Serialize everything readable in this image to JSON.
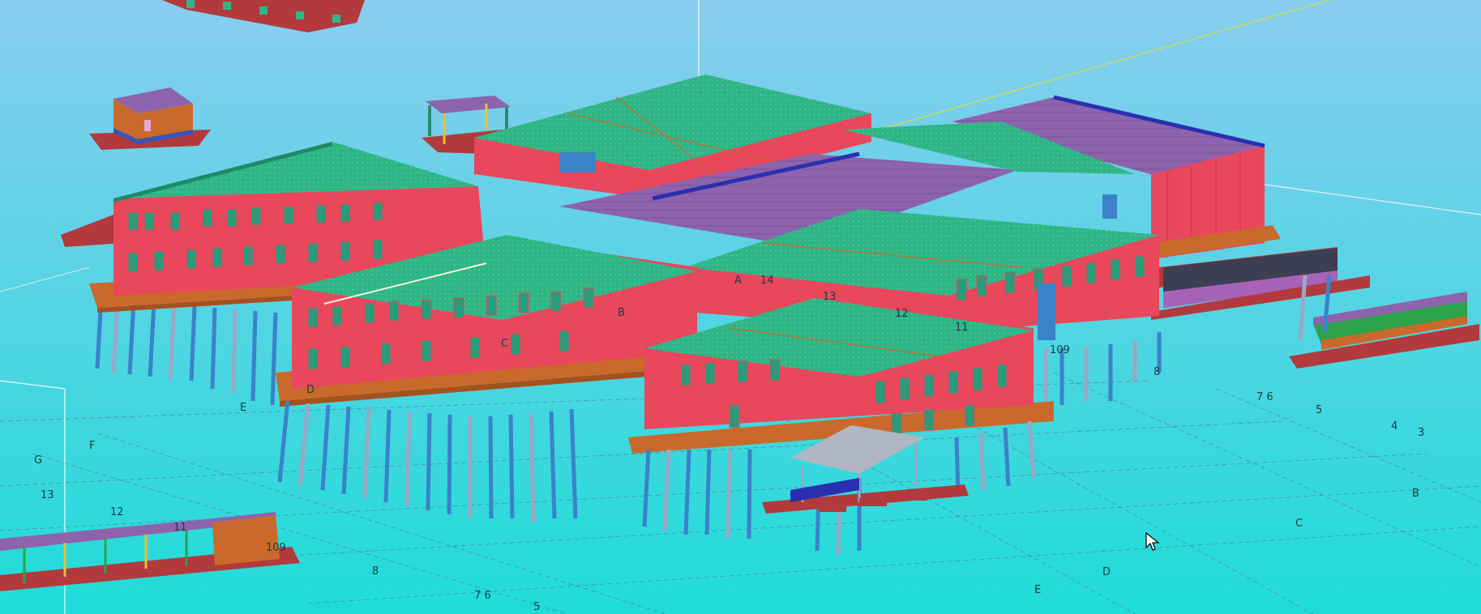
{
  "viewport": {
    "background_top": "#89cdef",
    "background_bottom": "#1fdcd8"
  },
  "colors": {
    "wall": "#e8475c",
    "wall_dark": "#c93347",
    "roof": "#2fb586",
    "roof_light": "#3cc694",
    "roof_purple": "#8e63ae",
    "slab": "#c96a2c",
    "slab_dark": "#a4511e",
    "foundation": "#b23a3c",
    "column_blue": "#3b82c9",
    "column_grey": "#9aa8c4",
    "window": "#2a9a78",
    "dark_panel": "#3e3e52",
    "canopy": "#b0b6c4"
  },
  "grid_labels": {
    "top_a": "A",
    "top_14": "14",
    "top_13": "13",
    "top_12": "12",
    "top_11": "11",
    "top_109": "109",
    "r_76": "7 6",
    "r_5": "5",
    "r_4": "4",
    "r_3": "3",
    "r_8": "8",
    "r_b": "B",
    "r_c": "C",
    "b_d": "D",
    "b_e": "E",
    "b_8": "8",
    "b_76": "7 6",
    "b_5": "5",
    "l_e": "E",
    "l_f": "F",
    "l_g": "G",
    "l_13": "13",
    "l_12": "12",
    "l_11": "11",
    "l_109": "109",
    "m_d": "D",
    "m_c": "C",
    "m_b": "B"
  },
  "icons": {
    "cursor": "mouse-pointer-icon"
  }
}
